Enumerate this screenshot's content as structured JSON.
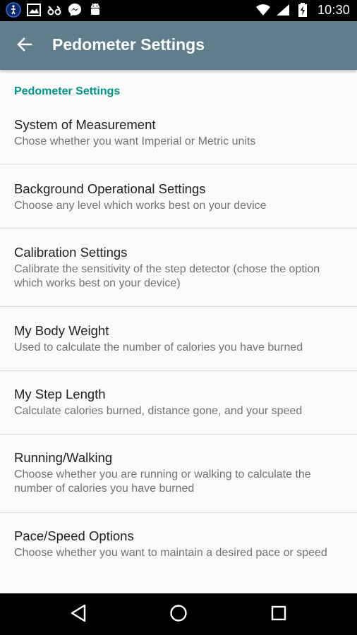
{
  "status_bar": {
    "time": "10:30",
    "left_icons": [
      "accessibility-icon",
      "image-icon",
      "voicemail-icon",
      "messenger-icon",
      "android-icon"
    ],
    "right_icons": [
      "wifi-icon",
      "signal-icon",
      "battery-charging-icon"
    ]
  },
  "app_bar": {
    "title": "Pedometer Settings",
    "back_icon": "arrow-back-icon",
    "background": "#607d8b"
  },
  "section": {
    "title": "Pedometer Settings",
    "accent": "#009688"
  },
  "settings": [
    {
      "title": "System of Measurement",
      "summary": "Chose whether you want Imperial or Metric units"
    },
    {
      "title": "Background Operational Settings",
      "summary": "Choose any level which works best on your device"
    },
    {
      "title": "Calibration Settings",
      "summary": "Calibrate the sensitivity of the step detector (chose the option which works best on your device)"
    },
    {
      "title": "My Body Weight",
      "summary": "Used to calculate the number of calories you have burned"
    },
    {
      "title": "My Step Length",
      "summary": "Calculate calories burned, distance gone, and your speed"
    },
    {
      "title": "Running/Walking",
      "summary": "Choose whether you are running or walking to calculate the number of calories you have burned"
    },
    {
      "title": "Pace/Speed Options",
      "summary": "Choose whether you want to maintain a desired pace or speed"
    }
  ],
  "nav_bar": {
    "icons": [
      "back-triangle-icon",
      "home-circle-icon",
      "recents-square-icon"
    ]
  }
}
